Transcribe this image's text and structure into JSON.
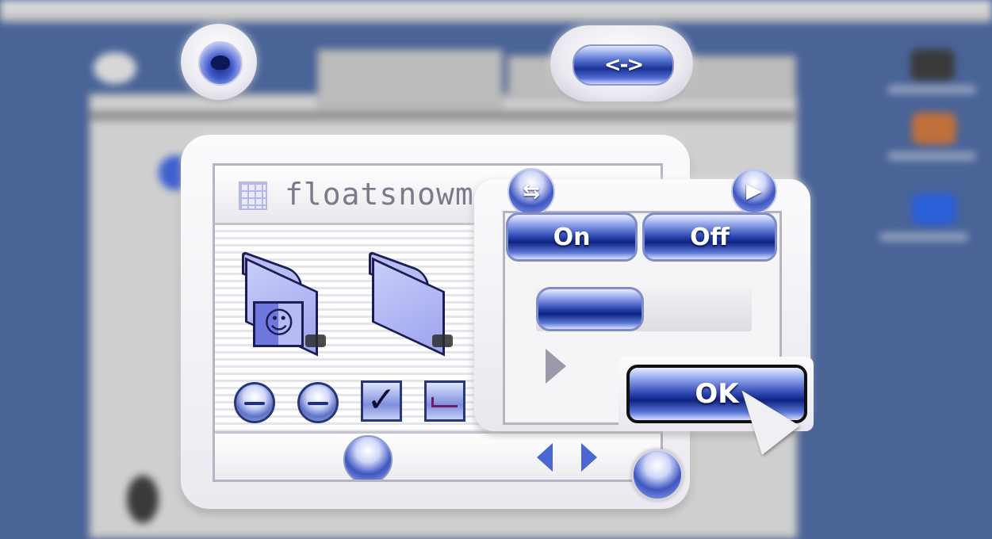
{
  "window": {
    "title": "floatsnowm"
  },
  "toolbar_pill": {
    "label": "<->"
  },
  "panel": {
    "collapse_glyph": "⇆",
    "next_glyph": "▶",
    "on_label": "On",
    "off_label": "Off",
    "progress": 0.5,
    "ok_label": "OK"
  },
  "controls": {
    "checkbox_checked": true,
    "checkmark_glyph": "✓"
  },
  "colors": {
    "desktop": "#4a6498",
    "accent_blue": "#2a44ae",
    "window_chrome": "#ebeaf0"
  },
  "icons": [
    "eye-icon",
    "arrows-icon",
    "grid-icon",
    "finder-folder-icon",
    "folder-icon",
    "checkbox-icon",
    "popup-icon",
    "arrow-left-icon",
    "arrow-right-icon",
    "resize-icon",
    "cursor-icon"
  ]
}
